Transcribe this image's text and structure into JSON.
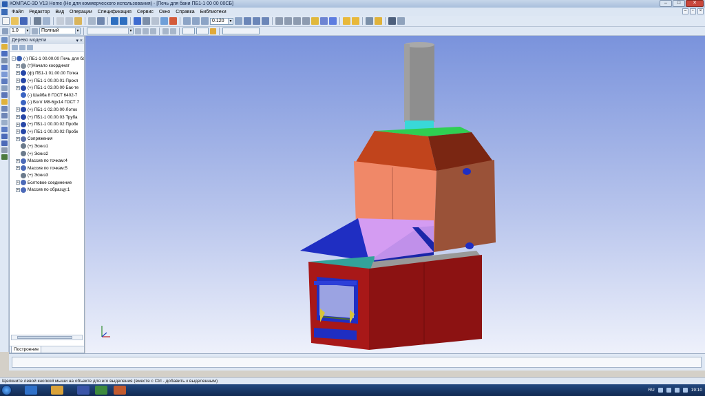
{
  "window": {
    "title": "КОМПАС-3D V13 Home (Не для коммерческого использования) - [Печь для бани ПБ1-1 00 00 00СБ]"
  },
  "menu": [
    "Файл",
    "Редактор",
    "Вид",
    "Операции",
    "Спецификация",
    "Сервис",
    "Окно",
    "Справка",
    "Библиотеки"
  ],
  "toolbar": {
    "zoom_value": "0.120",
    "line_scale": "1.0",
    "display_mode": "Полный"
  },
  "model_tree": {
    "title": "Дерево модели",
    "items": [
      {
        "label": "(-) ПБ1-1 00.00.00 Печь для ба",
        "level": 0,
        "expander": "−",
        "icon": "assembly-icon",
        "color": "#3a5fb4"
      },
      {
        "label": "(т)Начало координат",
        "level": 1,
        "expander": "+",
        "icon": "origin-icon",
        "color": "#7f8c9a"
      },
      {
        "label": "(ф) ПБ1-1 01.00.00 Топка",
        "level": 1,
        "expander": "+",
        "icon": "part-icon",
        "color": "#2747a8"
      },
      {
        "label": "(+) ПБ1-1 00.00.01 Прокл",
        "level": 1,
        "expander": "+",
        "icon": "part-icon",
        "color": "#2747a8"
      },
      {
        "label": "(+) ПБ1-1 03.00.00 Бак-те",
        "level": 1,
        "expander": "+",
        "icon": "part-icon",
        "color": "#2747a8"
      },
      {
        "label": "(-) Шайба 8  ГОСТ 6402-7",
        "level": 1,
        "expander": "",
        "icon": "washer-icon",
        "color": "#3b64c2"
      },
      {
        "label": "(-) Болт М8-6gх14 ГОСТ 7",
        "level": 1,
        "expander": "",
        "icon": "bolt-icon",
        "color": "#3b64c2"
      },
      {
        "label": "(+) ПБ1-1 02.00.00 Лоток",
        "level": 1,
        "expander": "+",
        "icon": "part-icon",
        "color": "#2747a8"
      },
      {
        "label": "(+) ПБ1-1 00.00.03 Труба",
        "level": 1,
        "expander": "+",
        "icon": "part-icon",
        "color": "#2747a8"
      },
      {
        "label": "(+) ПБ1-1 00.00.02 Пробк",
        "level": 1,
        "expander": "+",
        "icon": "part-icon",
        "color": "#2747a8"
      },
      {
        "label": "(+) ПБ1-1 00.00.02 Пробк",
        "level": 1,
        "expander": "+",
        "icon": "part-icon",
        "color": "#2747a8"
      },
      {
        "label": "Сопряжения",
        "level": 1,
        "expander": "+",
        "icon": "mates-icon",
        "color": "#5a6fa8"
      },
      {
        "label": "(+) Эскиз1",
        "level": 1,
        "expander": "",
        "icon": "sketch-icon",
        "color": "#6b7a8c"
      },
      {
        "label": "(+) Эскиз2",
        "level": 1,
        "expander": "",
        "icon": "sketch-icon",
        "color": "#6b7a8c"
      },
      {
        "label": "Массив по точкам:4",
        "level": 1,
        "expander": "+",
        "icon": "array-icon",
        "color": "#4c6ab8"
      },
      {
        "label": "Массив по точкам:5",
        "level": 1,
        "expander": "+",
        "icon": "array-icon",
        "color": "#4c6ab8"
      },
      {
        "label": "(+) Эскиз3",
        "level": 1,
        "expander": "",
        "icon": "sketch-icon",
        "color": "#6b7a8c"
      },
      {
        "label": "Болтовое соединение",
        "level": 1,
        "expander": "+",
        "icon": "bolt-joint-icon",
        "color": "#4c6ab8"
      },
      {
        "label": "Массив по образцу:1",
        "level": 1,
        "expander": "+",
        "icon": "pattern-icon",
        "color": "#4c6ab8"
      }
    ],
    "tab": "Построение"
  },
  "status_text": "Щелкните левой кнопкой мыши на объекте для его выделения (вместе с Ctrl - добавить к выделенным)",
  "taskbar": {
    "language": "RU",
    "clock": "19:10"
  },
  "colors": {
    "viewport_top": "#7a93dc",
    "chimney": "#8e8e8e",
    "collar": "#39d8d8",
    "hood_top": "#2fcf52",
    "hood": "#c1441c",
    "tank": "#f08868",
    "tray": "#1f2ec2",
    "firebox": "#a81818"
  }
}
